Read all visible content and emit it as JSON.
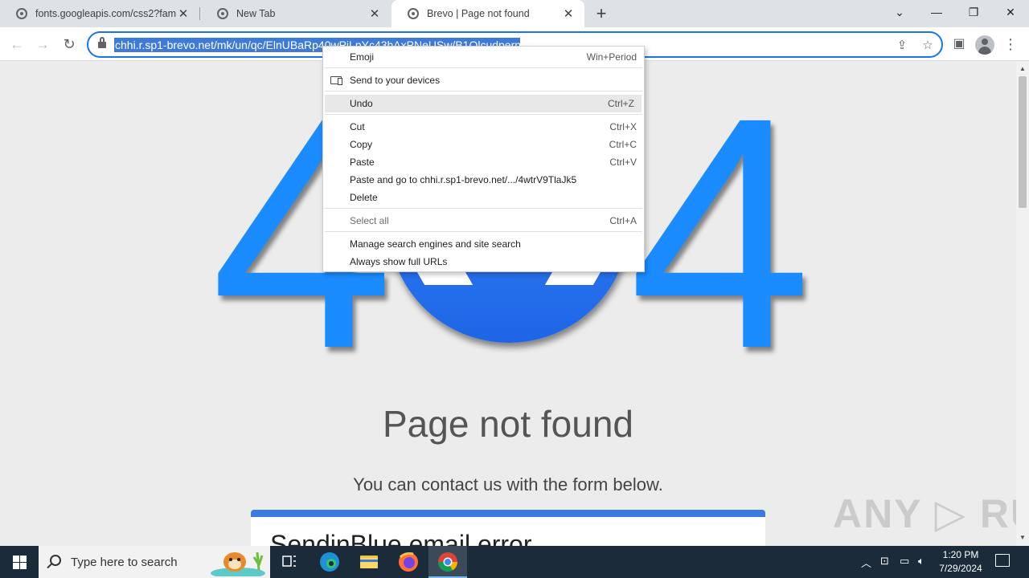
{
  "tabs": [
    {
      "title": "fonts.googleapis.com/css2?fam",
      "close": "✕"
    },
    {
      "title": "New Tab",
      "close": "✕"
    },
    {
      "title": "Brevo | Page not found",
      "close": "✕"
    }
  ],
  "new_tab": "+",
  "window_controls": {
    "tabsearch": "⌄",
    "minimize": "—",
    "restore": "❐",
    "close": "✕"
  },
  "toolbar": {
    "back": "←",
    "forward": "→",
    "reload": "↻",
    "url_selected": "chhi.r.sp1-brevo.net/mk/un/qc/ElnUBaRp40wPiLpYc43hAxPNeUSw/B1OlcudpernG",
    "share": "⇪",
    "bookmark": "☆",
    "sidepanel": "▣",
    "menu": "⋮"
  },
  "context_menu": {
    "items": [
      {
        "label": "Emoji",
        "shortcut": "Win+Period"
      },
      {
        "label": "Send to your devices",
        "shortcut": ""
      },
      {
        "label": "Undo",
        "shortcut": "Ctrl+Z"
      },
      {
        "label": "Cut",
        "shortcut": "Ctrl+X"
      },
      {
        "label": "Copy",
        "shortcut": "Ctrl+C"
      },
      {
        "label": "Paste",
        "shortcut": "Ctrl+V"
      },
      {
        "label": "Paste and go to chhi.r.sp1-brevo.net/.../4wtrV9TlaJk5",
        "shortcut": ""
      },
      {
        "label": "Delete",
        "shortcut": ""
      },
      {
        "label": "Select all",
        "shortcut": "Ctrl+A"
      },
      {
        "label": "Manage search engines and site search",
        "shortcut": ""
      },
      {
        "label": "Always show full URLs",
        "shortcut": ""
      }
    ]
  },
  "page": {
    "big_digit_left": "4",
    "big_digit_right": "4",
    "heading": "Page not found",
    "subheading": "You can contact us with the form below.",
    "form_title": "SendinBlue email error",
    "watermark": "ANY ▷ RUN"
  },
  "taskbar": {
    "search_placeholder": "Type here to search",
    "time": "1:20 PM",
    "date": "7/29/2024"
  },
  "colors": {
    "accent": "#1a73e8",
    "digit": "#1a8cff",
    "taskbar": "#1c2b3a"
  }
}
